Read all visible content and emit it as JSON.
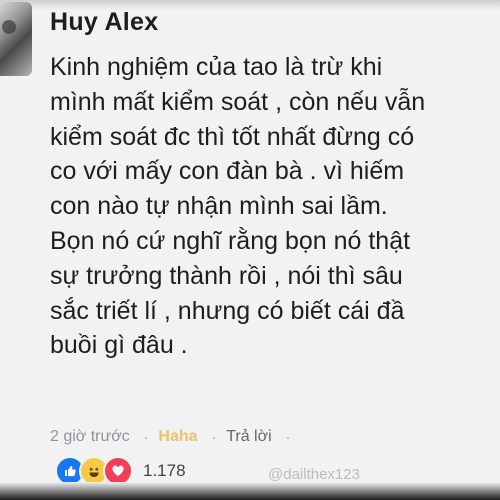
{
  "comment": {
    "author": "Huy Alex",
    "body_lines": [
      "Kinh nghiệm của tao là trừ khi",
      "mình mất kiểm soát , còn nếu vẫn",
      "kiểm soát đc thì tốt nhất đừng có",
      "co với mấy con đàn bà . vì hiếm",
      "con nào tự nhận mình sai lầm.",
      "Bọn nó cứ nghĩ rằng bọn nó thật",
      "sự trưởng thành rồi , nói thì sâu",
      "sắc triết lí , nhưng có biết cái đầ",
      "buồi gì đâu ."
    ],
    "time": "2 giờ trước",
    "reaction_label": "Haha",
    "reply_label": "Trả lời",
    "separator": "·",
    "reaction_count": "1.178",
    "reaction_icons": [
      "like-icon",
      "haha-icon",
      "love-icon"
    ]
  },
  "watermark": "@dailthex123",
  "colors": {
    "background": "#f2f2f2",
    "text": "#1c1e21",
    "meta": "#8d949e",
    "haha": "#e9c46a",
    "like": "#1877f2",
    "love": "#f33e58"
  }
}
